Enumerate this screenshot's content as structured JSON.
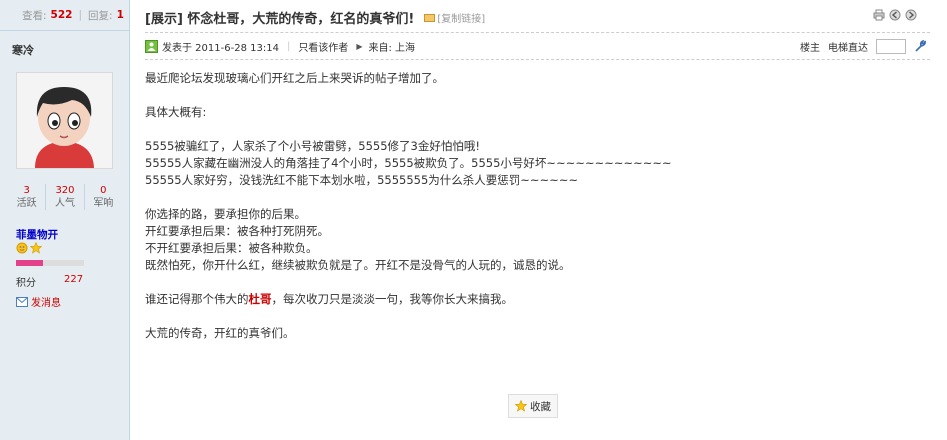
{
  "thread_stats": {
    "views_label": "查看:",
    "views": "522",
    "replies_label": "回复:",
    "replies": "1"
  },
  "author": {
    "name": "寒冷",
    "counts": [
      {
        "value": "3",
        "label": "活跃"
      },
      {
        "value": "320",
        "label": "人气"
      },
      {
        "value": "0",
        "label": "军响"
      }
    ],
    "group": "菲墨物开",
    "progress_fraction": 0.4,
    "score_label": "积分",
    "score": "227",
    "message_label": "发消息"
  },
  "post": {
    "title": "[展示] 怀念杜哥，大荒的传奇，红名的真爷们!",
    "copy_link": "[复制链接]",
    "posted": "发表于 2011-6-28 13:14",
    "only_author": "只看该作者",
    "source": "来自: 上海",
    "floor_label": "楼主",
    "jump_label": "电梯直达",
    "paragraphs": [
      "最近爬论坛发现玻璃心们开红之后上来哭诉的帖子增加了。",
      "",
      "具体大概有:",
      "",
      "5555被骗红了，人家杀了个小号被雷劈，5555修了3金好怕怕哦!",
      "55555人家藏在幽洲没人的角落挂了4个小时，5555被欺负了。5555小号好坏~~~~~~~~~~~~~",
      "55555人家好穷，没钱洗红不能下本划水啦，5555555为什么杀人要惩罚~~~~~~",
      "",
      "你选择的路，要承担你的后果。",
      "开红要承担后果：被各种打死阴死。",
      "不开红要承担后果：被各种欺负。",
      "既然怕死，你开什么红，继续被欺负就是了。开红不是没骨气的人玩的，诚恳的说。",
      "",
      "谁还记得那个伟大的杜哥，每次收刀只是淡淡一句，我等你长大来搞我。",
      "",
      "大荒的传奇，开红的真爷们。"
    ],
    "highlight_word": "杜哥",
    "favorite_label": "收藏"
  }
}
